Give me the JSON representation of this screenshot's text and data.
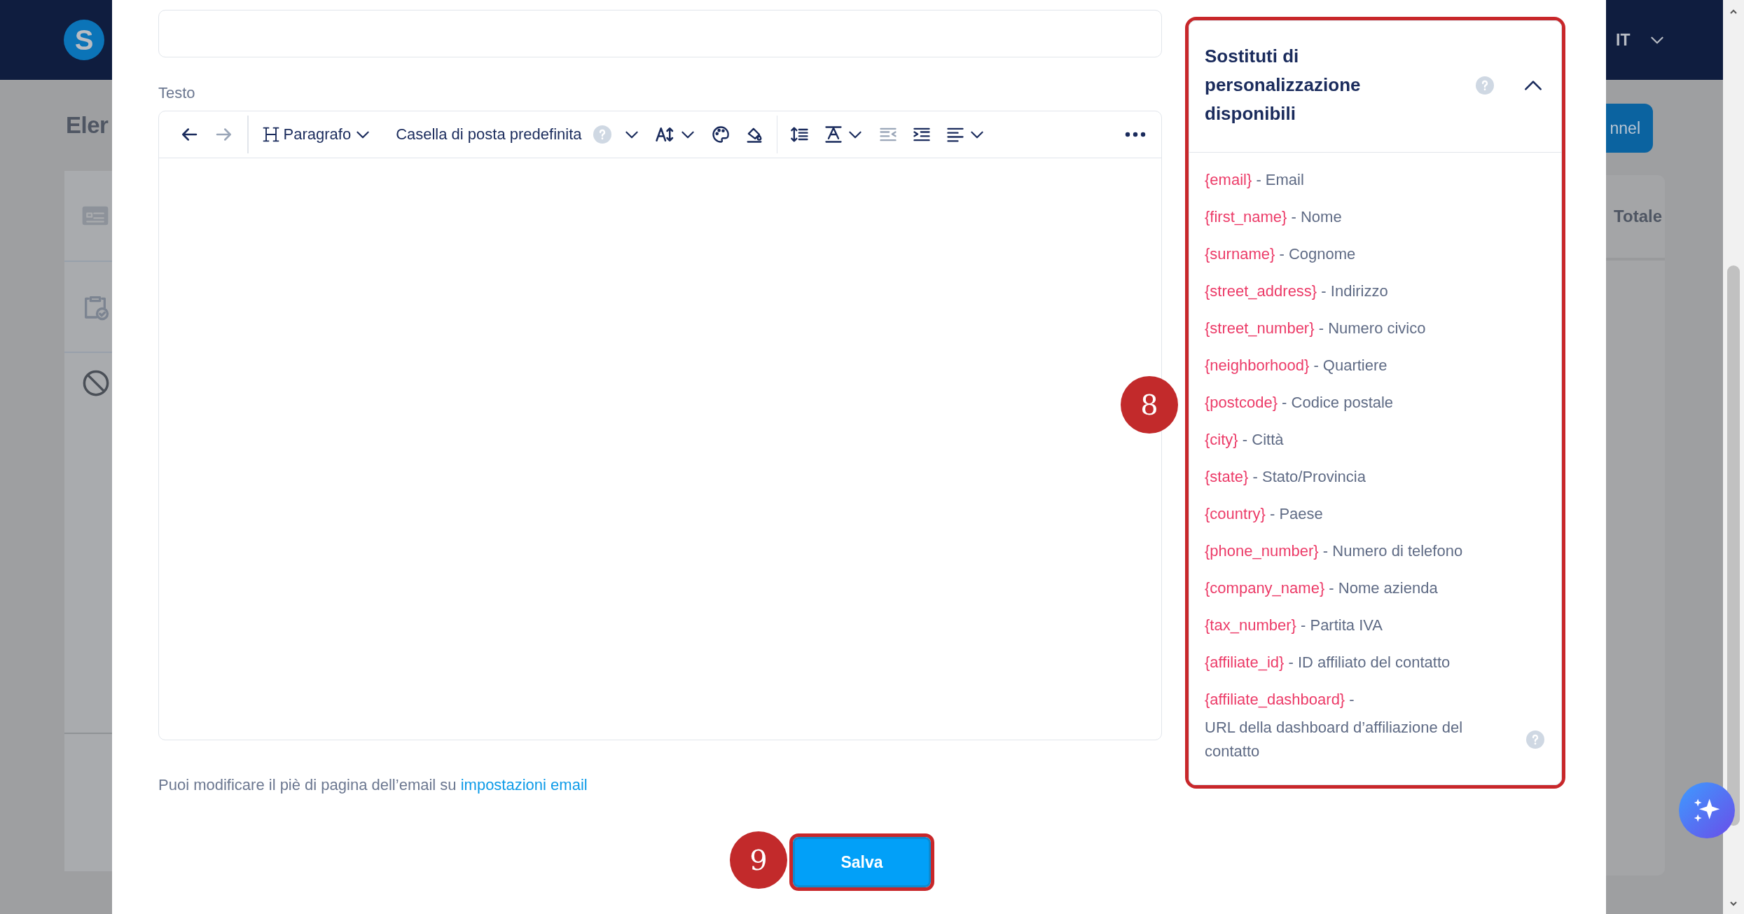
{
  "background": {
    "logo": "S",
    "page_title": "Eler",
    "language": "IT",
    "button": "nnel",
    "column_header": "Totale"
  },
  "form": {
    "body_label": "Testo",
    "toolbar": [
      {
        "kind": "undo",
        "disabled": false
      },
      {
        "kind": "redo",
        "disabled": true
      },
      {
        "kind": "divider"
      },
      {
        "kind": "heading",
        "label": "Paragrafo",
        "disabled": false
      },
      {
        "kind": "mailbox",
        "label": "Casella di posta predefinita",
        "disabled": false
      },
      {
        "kind": "font-size",
        "disabled": false
      },
      {
        "kind": "palette",
        "disabled": false
      },
      {
        "kind": "fill",
        "disabled": false
      },
      {
        "kind": "divider"
      },
      {
        "kind": "line-height",
        "disabled": false
      },
      {
        "kind": "text-color",
        "disabled": false
      },
      {
        "kind": "outdent",
        "disabled": true
      },
      {
        "kind": "indent",
        "disabled": false
      },
      {
        "kind": "align",
        "disabled": false
      },
      {
        "kind": "more",
        "disabled": false
      }
    ],
    "footer_text": "Puoi modificare il piè di pagina dell’email su",
    "footer_link": "impostazioni email",
    "save_button": {
      "label": "Salva",
      "highlighted": true
    }
  },
  "placeholders_panel": {
    "title": "Sostituti di personalizzazione disponibili",
    "expanded": true,
    "highlighted": true,
    "items": [
      {
        "token": "{email}",
        "separator": "-",
        "description": "Email",
        "help": false
      },
      {
        "token": "{first_name}",
        "separator": "-",
        "description": "Nome",
        "help": false
      },
      {
        "token": "{surname}",
        "separator": "-",
        "description": "Cognome",
        "help": false
      },
      {
        "token": "{street_address}",
        "separator": "-",
        "description": "Indirizzo",
        "help": false
      },
      {
        "token": "{street_number}",
        "separator": "-",
        "description": "Numero civico",
        "help": false
      },
      {
        "token": "{neighborhood}",
        "separator": "-",
        "description": "Quartiere",
        "help": false
      },
      {
        "token": "{postcode}",
        "separator": "-",
        "description": "Codice postale",
        "help": false
      },
      {
        "token": "{city}",
        "separator": "-",
        "description": "Città",
        "help": false
      },
      {
        "token": "{state}",
        "separator": "-",
        "description": "Stato/Provincia",
        "help": false
      },
      {
        "token": "{country}",
        "separator": "-",
        "description": "Paese",
        "help": false
      },
      {
        "token": "{phone_number}",
        "separator": "-",
        "description": "Numero di telefono",
        "help": false
      },
      {
        "token": "{company_name}",
        "separator": "-",
        "description": "Nome azienda",
        "help": false
      },
      {
        "token": "{tax_number}",
        "separator": "-",
        "description": "Partita IVA",
        "help": false
      },
      {
        "token": "{affiliate_id}",
        "separator": "-",
        "description": "ID affiliato del contatto",
        "help": false
      },
      {
        "token": "{affiliate_dashboard}",
        "separator": "-",
        "description": "URL della dashboard d’affiliazione del contatto",
        "help": true
      }
    ]
  },
  "annotations": [
    {
      "label": "8"
    },
    {
      "label": "9"
    }
  ]
}
